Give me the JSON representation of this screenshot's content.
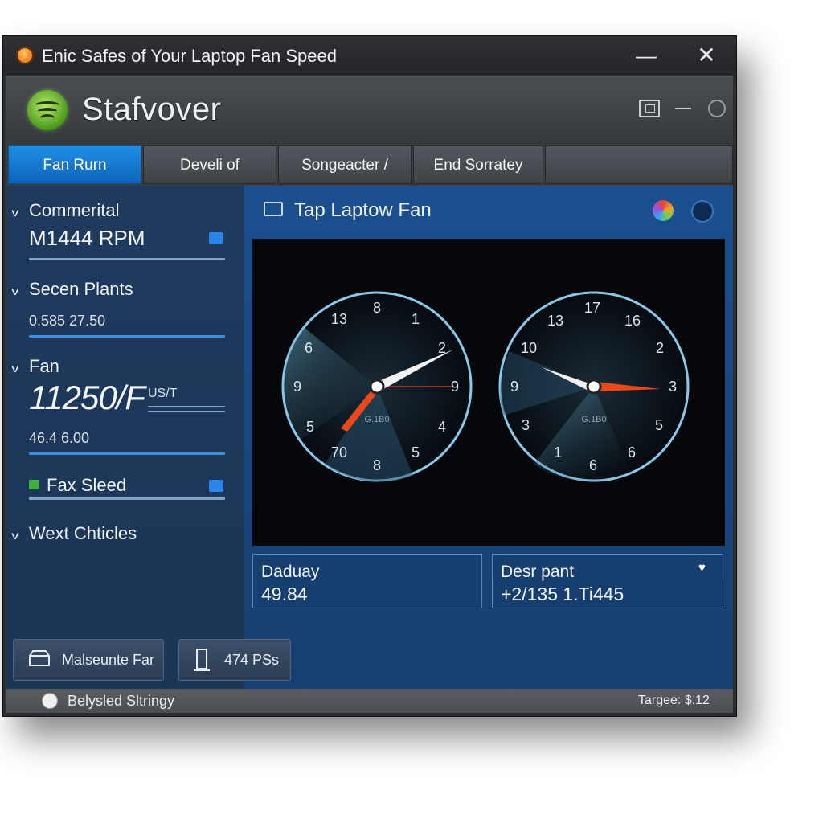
{
  "window": {
    "title": "Enic Safes of Your Laptop Fan Speed",
    "minimize_glyph": "—",
    "close_glyph": "✕"
  },
  "header": {
    "logo_text": "Stafvover",
    "icons": [
      "display-icon",
      "minimize-dash-icon",
      "circle-icon"
    ]
  },
  "tabs": [
    {
      "label": "Fan Rurn",
      "active": true
    },
    {
      "label": "Develi of",
      "active": false
    },
    {
      "label": "Songeacter /",
      "active": false
    },
    {
      "label": "End Sorratey",
      "active": false
    },
    {
      "label": "",
      "active": false
    }
  ],
  "sidebar": {
    "sections": [
      {
        "title": "Commerital",
        "value": "M1444 RPM"
      },
      {
        "title": "Secen Plants",
        "value": "0.585 27.50"
      },
      {
        "title": "Fan",
        "value": "11250/F",
        "unit": "US/T",
        "sub": "46.4 6.00"
      },
      {
        "title": "Fax Sleed"
      },
      {
        "title": "Wext Chticles"
      }
    ]
  },
  "panel": {
    "title": "Tap Laptow Fan",
    "gauges": [
      {
        "numbers": [
          "8",
          "1",
          "2",
          "9",
          "4",
          "5",
          "8",
          "70",
          "5",
          "9",
          "6",
          "13"
        ],
        "center_label": "G.1B0"
      },
      {
        "numbers": [
          "17",
          "16",
          "2",
          "3",
          "5",
          "6",
          "6",
          "1",
          "3",
          "9",
          "10",
          "13"
        ],
        "center_label": "G.1B0"
      }
    ],
    "readouts": [
      {
        "label": "Daduay",
        "value": "49.84"
      },
      {
        "label": "Desr pant",
        "value": "+2/135 1.Ti445"
      }
    ]
  },
  "buttons": [
    {
      "label": "Malseunte Far"
    },
    {
      "label": "474 PSs"
    }
  ],
  "status": {
    "left": "Belysled Sltringy",
    "right": "Targee: $.12"
  },
  "colors": {
    "accent": "#1f8ee6",
    "needle_red": "#e8481c",
    "sidebar_bg": "#1f3a5d",
    "panel_bg": "#1b4f8e"
  }
}
